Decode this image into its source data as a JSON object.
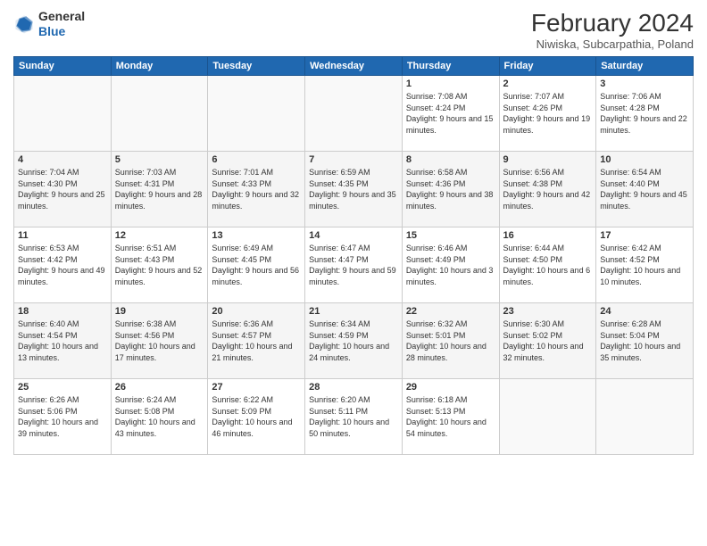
{
  "header": {
    "logo_general": "General",
    "logo_blue": "Blue",
    "month": "February 2024",
    "location": "Niwiska, Subcarpathia, Poland"
  },
  "days_of_week": [
    "Sunday",
    "Monday",
    "Tuesday",
    "Wednesday",
    "Thursday",
    "Friday",
    "Saturday"
  ],
  "weeks": [
    [
      {
        "day": "",
        "info": ""
      },
      {
        "day": "",
        "info": ""
      },
      {
        "day": "",
        "info": ""
      },
      {
        "day": "",
        "info": ""
      },
      {
        "day": "1",
        "info": "Sunrise: 7:08 AM\nSunset: 4:24 PM\nDaylight: 9 hours\nand 15 minutes."
      },
      {
        "day": "2",
        "info": "Sunrise: 7:07 AM\nSunset: 4:26 PM\nDaylight: 9 hours\nand 19 minutes."
      },
      {
        "day": "3",
        "info": "Sunrise: 7:06 AM\nSunset: 4:28 PM\nDaylight: 9 hours\nand 22 minutes."
      }
    ],
    [
      {
        "day": "4",
        "info": "Sunrise: 7:04 AM\nSunset: 4:30 PM\nDaylight: 9 hours\nand 25 minutes."
      },
      {
        "day": "5",
        "info": "Sunrise: 7:03 AM\nSunset: 4:31 PM\nDaylight: 9 hours\nand 28 minutes."
      },
      {
        "day": "6",
        "info": "Sunrise: 7:01 AM\nSunset: 4:33 PM\nDaylight: 9 hours\nand 32 minutes."
      },
      {
        "day": "7",
        "info": "Sunrise: 6:59 AM\nSunset: 4:35 PM\nDaylight: 9 hours\nand 35 minutes."
      },
      {
        "day": "8",
        "info": "Sunrise: 6:58 AM\nSunset: 4:36 PM\nDaylight: 9 hours\nand 38 minutes."
      },
      {
        "day": "9",
        "info": "Sunrise: 6:56 AM\nSunset: 4:38 PM\nDaylight: 9 hours\nand 42 minutes."
      },
      {
        "day": "10",
        "info": "Sunrise: 6:54 AM\nSunset: 4:40 PM\nDaylight: 9 hours\nand 45 minutes."
      }
    ],
    [
      {
        "day": "11",
        "info": "Sunrise: 6:53 AM\nSunset: 4:42 PM\nDaylight: 9 hours\nand 49 minutes."
      },
      {
        "day": "12",
        "info": "Sunrise: 6:51 AM\nSunset: 4:43 PM\nDaylight: 9 hours\nand 52 minutes."
      },
      {
        "day": "13",
        "info": "Sunrise: 6:49 AM\nSunset: 4:45 PM\nDaylight: 9 hours\nand 56 minutes."
      },
      {
        "day": "14",
        "info": "Sunrise: 6:47 AM\nSunset: 4:47 PM\nDaylight: 9 hours\nand 59 minutes."
      },
      {
        "day": "15",
        "info": "Sunrise: 6:46 AM\nSunset: 4:49 PM\nDaylight: 10 hours\nand 3 minutes."
      },
      {
        "day": "16",
        "info": "Sunrise: 6:44 AM\nSunset: 4:50 PM\nDaylight: 10 hours\nand 6 minutes."
      },
      {
        "day": "17",
        "info": "Sunrise: 6:42 AM\nSunset: 4:52 PM\nDaylight: 10 hours\nand 10 minutes."
      }
    ],
    [
      {
        "day": "18",
        "info": "Sunrise: 6:40 AM\nSunset: 4:54 PM\nDaylight: 10 hours\nand 13 minutes."
      },
      {
        "day": "19",
        "info": "Sunrise: 6:38 AM\nSunset: 4:56 PM\nDaylight: 10 hours\nand 17 minutes."
      },
      {
        "day": "20",
        "info": "Sunrise: 6:36 AM\nSunset: 4:57 PM\nDaylight: 10 hours\nand 21 minutes."
      },
      {
        "day": "21",
        "info": "Sunrise: 6:34 AM\nSunset: 4:59 PM\nDaylight: 10 hours\nand 24 minutes."
      },
      {
        "day": "22",
        "info": "Sunrise: 6:32 AM\nSunset: 5:01 PM\nDaylight: 10 hours\nand 28 minutes."
      },
      {
        "day": "23",
        "info": "Sunrise: 6:30 AM\nSunset: 5:02 PM\nDaylight: 10 hours\nand 32 minutes."
      },
      {
        "day": "24",
        "info": "Sunrise: 6:28 AM\nSunset: 5:04 PM\nDaylight: 10 hours\nand 35 minutes."
      }
    ],
    [
      {
        "day": "25",
        "info": "Sunrise: 6:26 AM\nSunset: 5:06 PM\nDaylight: 10 hours\nand 39 minutes."
      },
      {
        "day": "26",
        "info": "Sunrise: 6:24 AM\nSunset: 5:08 PM\nDaylight: 10 hours\nand 43 minutes."
      },
      {
        "day": "27",
        "info": "Sunrise: 6:22 AM\nSunset: 5:09 PM\nDaylight: 10 hours\nand 46 minutes."
      },
      {
        "day": "28",
        "info": "Sunrise: 6:20 AM\nSunset: 5:11 PM\nDaylight: 10 hours\nand 50 minutes."
      },
      {
        "day": "29",
        "info": "Sunrise: 6:18 AM\nSunset: 5:13 PM\nDaylight: 10 hours\nand 54 minutes."
      },
      {
        "day": "",
        "info": ""
      },
      {
        "day": "",
        "info": ""
      }
    ]
  ]
}
